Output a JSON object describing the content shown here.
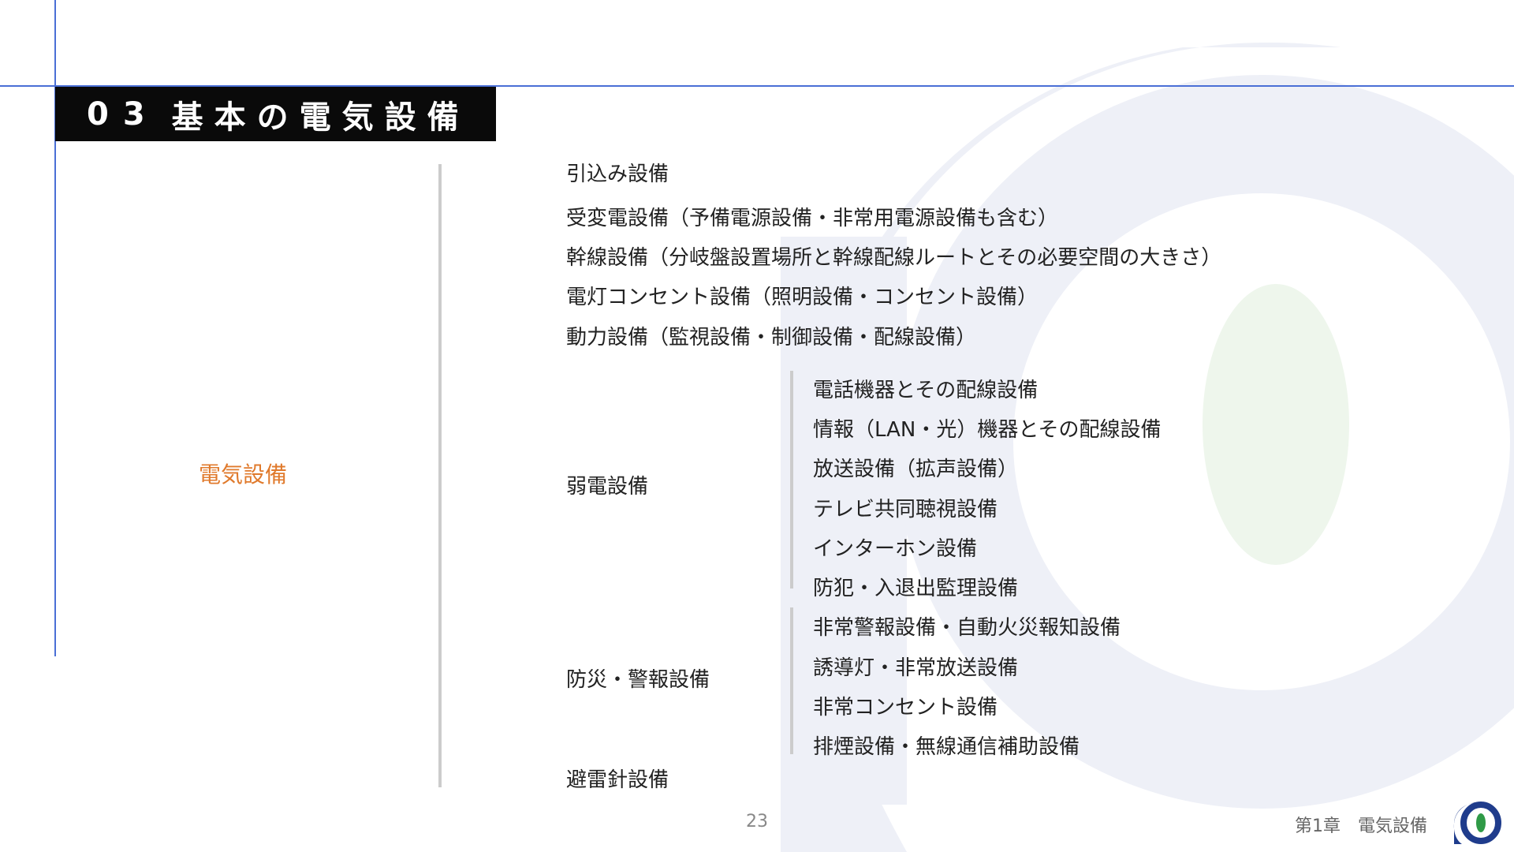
{
  "slide": {
    "section_number": "03",
    "section_title": "基本の電気設備",
    "main_category": "電気設備",
    "page_number": "23",
    "chapter_label": "第1章　電気設備"
  },
  "top_items": [
    "引込み設備",
    "受変電設備（予備電源設備・非常用電源設備も含む）",
    "幹線設備（分岐盤設置場所と幹線配線ルートとその必要空間の大きさ）",
    "電灯コンセント設備（照明設備・コンセント設備）",
    "動力設備（監視設備・制御設備・配線設備）"
  ],
  "weak_current": {
    "label": "弱電設備",
    "items": [
      "電話機器とその配線設備",
      "情報（LAN・光）機器とその配線設備",
      "放送設備（拡声設備）",
      "テレビ共同聴視設備",
      "インターホン設備",
      "防犯・入退出監理設備"
    ]
  },
  "disaster_prevention": {
    "label": "防災・警報設備",
    "items": [
      "非常警報設備・自動火災報知設備",
      "誘導灯・非常放送設備",
      "非常コンセント設備",
      "排煙設備・無線通信補助設備"
    ]
  },
  "lightning_rod": {
    "label": "避雷針設備"
  },
  "colors": {
    "accent_line": "#4a6fd6",
    "title_bar": "#0a0a0a",
    "category_label": "#e07a2c",
    "watermark_blue": "#eef0f7",
    "watermark_green": "#eef6ec",
    "logo_blue": "#1f3c8c",
    "logo_green": "#2f9a47"
  }
}
